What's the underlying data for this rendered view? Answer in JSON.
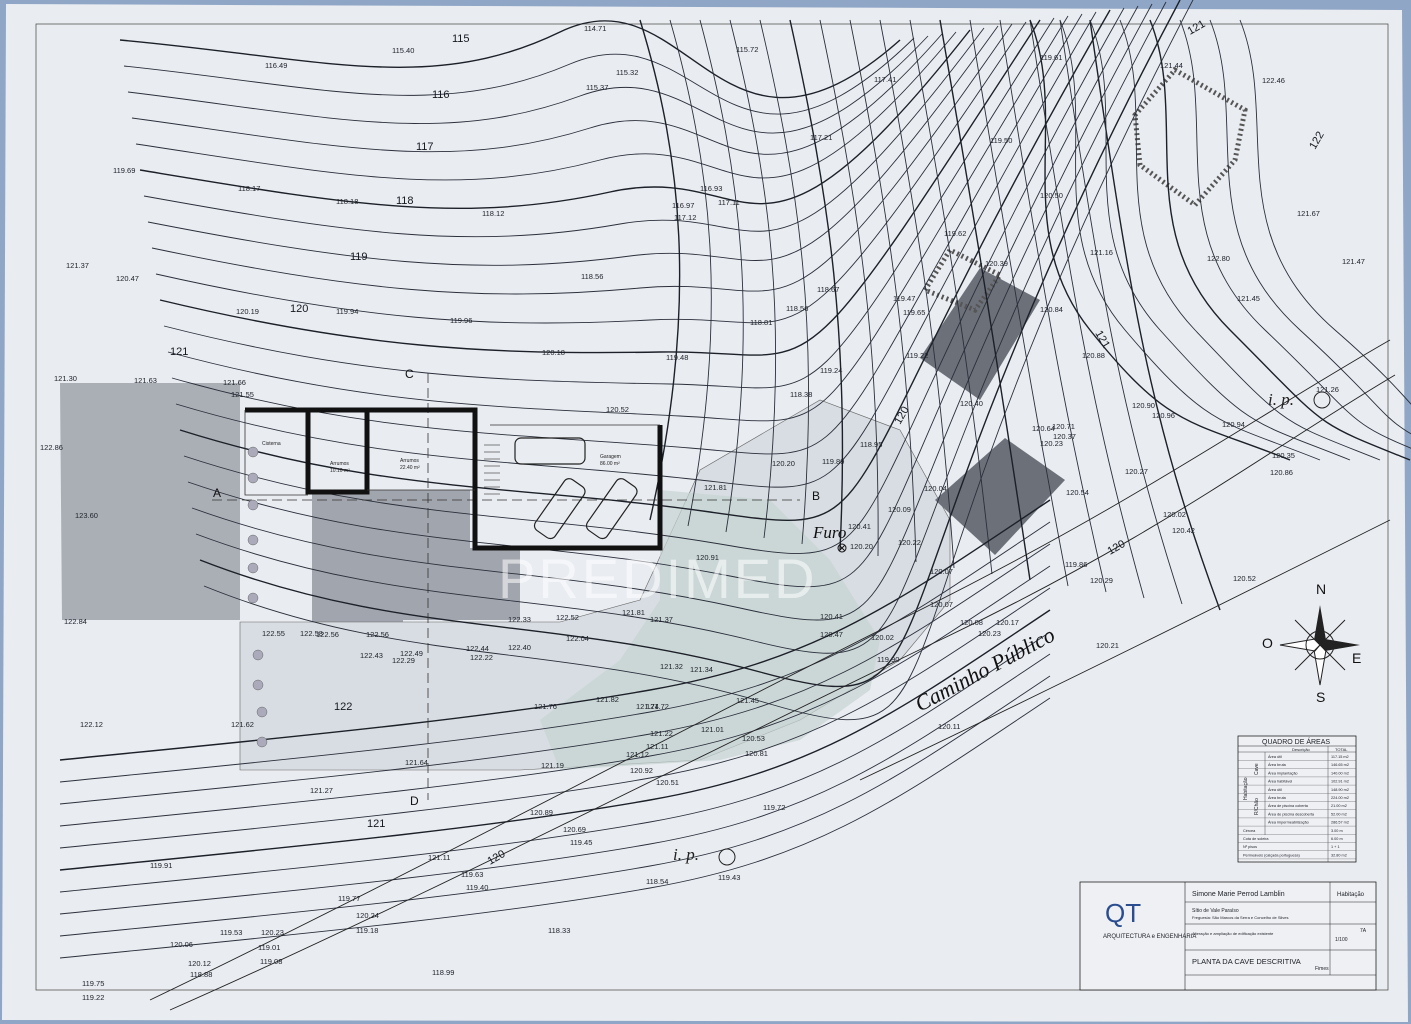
{
  "road_label": "Caminho Público",
  "well_label": "Furo",
  "ip_label": "i. p.",
  "watermark": "PREDIMED",
  "section_markers": [
    "A",
    "B",
    "C",
    "D"
  ],
  "compass": {
    "n": "N",
    "s": "S",
    "e": "E",
    "w": "O"
  },
  "contour_labels": [
    "115",
    "116",
    "117",
    "118",
    "119",
    "120",
    "121",
    "121",
    "121",
    "122",
    "120",
    "120",
    "120",
    "121",
    "122"
  ],
  "elevations": [
    "114.71",
    "115.40",
    "115.72",
    "116.49",
    "115.32",
    "115.37",
    "117.41",
    "119.61",
    "121.44",
    "122.46",
    "117.21",
    "119.69",
    "118.17",
    "118.18",
    "118.12",
    "116.93",
    "117.11",
    "116.97",
    "117.12",
    "119.50",
    "121.16",
    "120.50",
    "121.67",
    "121.37",
    "120.47",
    "118.56",
    "119.62",
    "120.39",
    "122.80",
    "121.47",
    "120.19",
    "119.94",
    "119.96",
    "118.67",
    "118.56",
    "118.81",
    "119.47",
    "119.65",
    "120.84",
    "121.45",
    "120.18",
    "119.48",
    "119.22",
    "120.88",
    "121.30",
    "121.63",
    "121.66",
    "121.55",
    "119.24",
    "118.38",
    "120.40",
    "120.52",
    "121.26",
    "120.90",
    "120.96",
    "120.94",
    "120.71",
    "122.86",
    "118.95",
    "120.37",
    "120.23",
    "120.35",
    "120.86",
    "120.20",
    "119.89",
    "120.54",
    "120.64",
    "120.27",
    "121.81",
    "120.41",
    "120.09",
    "120.04",
    "123.60",
    "120.20",
    "120.22",
    "120.07",
    "120.02",
    "120.42",
    "120.91",
    "119.86",
    "120.29",
    "120.52",
    "122.84",
    "122.33",
    "122.52",
    "121.81",
    "121.37",
    "120.41",
    "120.07",
    "120.08",
    "120.17",
    "120.23",
    "122.55",
    "122.58",
    "122.56",
    "122.56",
    "122.04",
    "120.47",
    "120.02",
    "120.21",
    "122.43",
    "122.49",
    "122.29",
    "122.44",
    "122.22",
    "122.40",
    "121.32",
    "121.34",
    "119.90",
    "122.12",
    "121.82",
    "121.74",
    "121.72",
    "121.45",
    "121.62",
    "121.76",
    "121.22",
    "121.11",
    "121.01",
    "120.53",
    "120.11",
    "121.64",
    "121.19",
    "121.12",
    "120.92",
    "120.81",
    "121.27",
    "120.89",
    "120.51",
    "119.72",
    "119.91",
    "121.11",
    "120.69",
    "119.45",
    "119.63",
    "119.40",
    "118.54",
    "119.77",
    "120.24",
    "119.18",
    "119.43",
    "119.53",
    "120.23",
    "120.06",
    "120.12",
    "119.01",
    "119.08",
    "118.33",
    "119.75",
    "118.88",
    "119.22",
    "118.99",
    "119.62"
  ],
  "plan_rooms": [
    {
      "name": "Cisterna"
    },
    {
      "name": "Arrumos",
      "area": "10.10 m²"
    },
    {
      "name": "Arrumos",
      "area": "22.40 m²"
    },
    {
      "name": "Garagem",
      "area": "86.00 m²"
    }
  ],
  "areas_table": {
    "title": "QUADRO DE ÁREAS",
    "headers": [
      "Descrição",
      "TOTAL"
    ],
    "group_labels": [
      "Habitação",
      "Cave",
      "R/Chão"
    ],
    "rows": [
      {
        "label": "Área útil",
        "value": "117.15 m2"
      },
      {
        "label": "Área bruta",
        "value": "146.65 m2"
      },
      {
        "label": "Área implantação",
        "value": "140.00 m2"
      },
      {
        "label": "Área habitável",
        "value": "102.91 m2"
      },
      {
        "label": "Área útil",
        "value": "148.90 m2"
      },
      {
        "label": "Área bruta",
        "value": "224.00 m2"
      },
      {
        "label": "Área de piscina coberta",
        "value": "21.00 m2"
      },
      {
        "label": "Área de piscina descoberta",
        "value": "52.00 m2"
      },
      {
        "label": "Área impermeabilização",
        "value": "286.57 m2"
      }
    ],
    "footer_rows": [
      {
        "label": "Cércea",
        "value": "3.00 m"
      },
      {
        "label": "Cota de soleira",
        "value": "6.00 m"
      },
      {
        "label": "Nº pisos",
        "value": "1 + 1"
      },
      {
        "label": "Permeáveis (calçada portuguesa)",
        "value": "32.80 m2"
      }
    ]
  },
  "title_block": {
    "firm_logo": "QT",
    "firm_name": "ARQUITECTURA e ENGENHARIA",
    "owner": "Simone Marie Perrod Lamblin",
    "use": "Habitação",
    "location": "Sítio de Vale Paraíso",
    "parish": "Freguesia: São Marcos da Serra e Concelho de Silves",
    "work": "Alteração e ampliação de edificação existente",
    "scale": "1/100",
    "sheet_no": "7A",
    "drawing_title": "PLANTA DA CAVE DESCRITIVA",
    "phase": "Fimes"
  }
}
